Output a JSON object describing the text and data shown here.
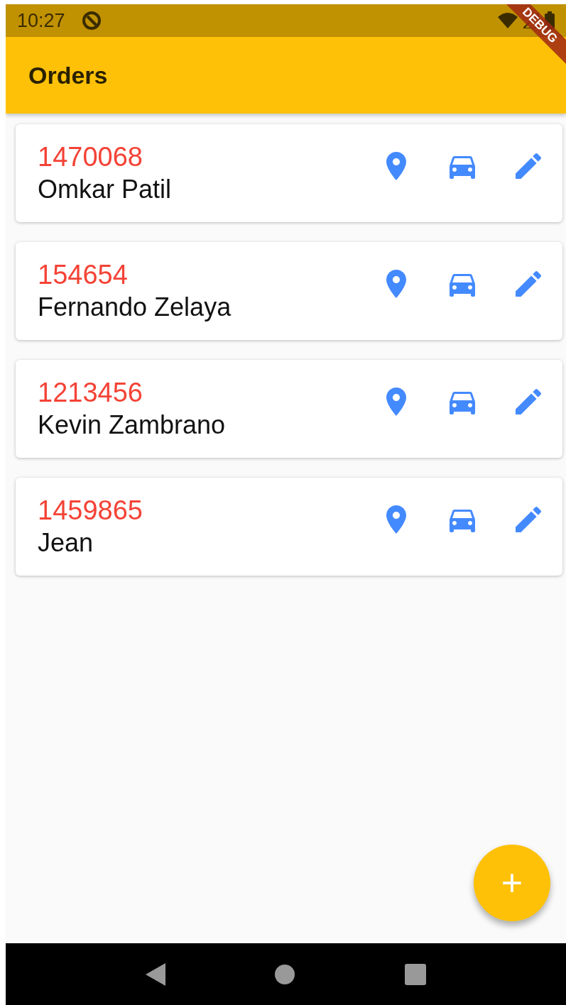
{
  "status_bar": {
    "time": "10:27"
  },
  "debug_banner": "DEBUG",
  "app_bar": {
    "title": "Orders"
  },
  "orders": [
    {
      "number": "1470068",
      "name": "Omkar Patil"
    },
    {
      "number": "154654",
      "name": "Fernando Zelaya"
    },
    {
      "number": "1213456",
      "name": "Kevin Zambrano"
    },
    {
      "number": "1459865",
      "name": "Jean"
    }
  ],
  "fab": {
    "label": "+"
  }
}
